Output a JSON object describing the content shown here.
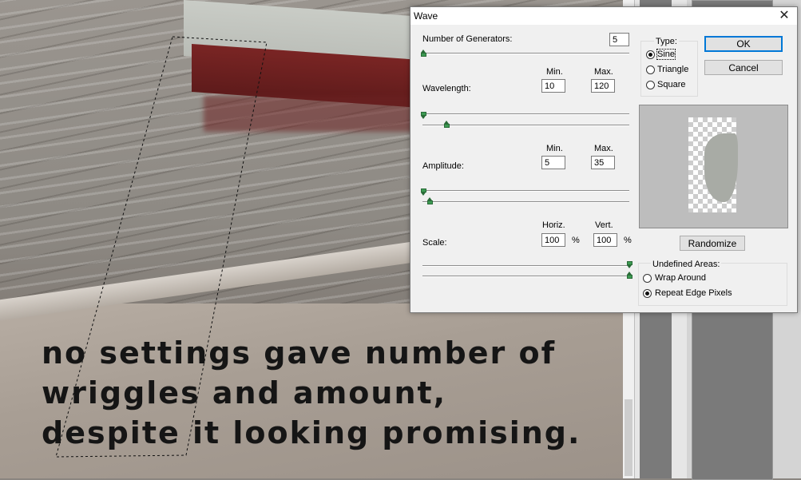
{
  "dialog": {
    "title": "Wave",
    "close_glyph": "✕",
    "generators": {
      "label": "Number of Generators:",
      "value": "5"
    },
    "type": {
      "label": "Type:",
      "options": [
        "Sine",
        "Triangle",
        "Square"
      ],
      "selected": "Sine"
    },
    "buttons": {
      "ok": "OK",
      "cancel": "Cancel",
      "randomize": "Randomize"
    },
    "wavelength": {
      "label": "Wavelength:",
      "min_label": "Min.",
      "max_label": "Max.",
      "min": "10",
      "max": "120"
    },
    "amplitude": {
      "label": "Amplitude:",
      "min_label": "Min.",
      "max_label": "Max.",
      "min": "5",
      "max": "35"
    },
    "scale": {
      "label": "Scale:",
      "horiz_label": "Horiz.",
      "vert_label": "Vert.",
      "horiz": "100",
      "vert": "100",
      "unit": "%"
    },
    "undefined_areas": {
      "label": "Undefined Areas:",
      "options": [
        "Wrap Around",
        "Repeat Edge Pixels"
      ],
      "selected": "Repeat Edge Pixels"
    },
    "accent_color": "#0078d7",
    "slider_thumb_color": "#3c9a52"
  },
  "caption": {
    "lines": [
      "no settings gave number of",
      "wriggles and amount,",
      "despite it looking promising."
    ]
  }
}
